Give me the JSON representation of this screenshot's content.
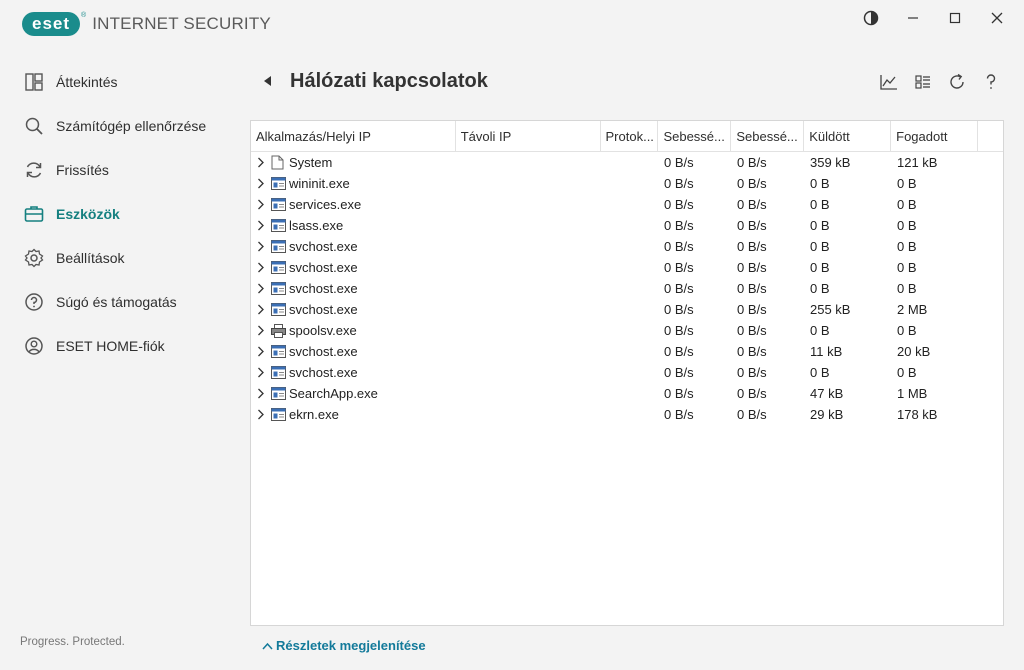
{
  "app": {
    "logo_text": "eset",
    "product_name": "INTERNET SECURITY"
  },
  "sidebar": {
    "items": [
      {
        "label": "Áttekintés",
        "icon": "overview-icon",
        "active": false
      },
      {
        "label": "Számítógép ellenőrzése",
        "icon": "scan-icon",
        "active": false
      },
      {
        "label": "Frissítés",
        "icon": "refresh-icon",
        "active": false
      },
      {
        "label": "Eszközök",
        "icon": "toolbox-icon",
        "active": true
      },
      {
        "label": "Beállítások",
        "icon": "gear-icon",
        "active": false
      },
      {
        "label": "Súgó és támogatás",
        "icon": "help-icon",
        "active": false
      },
      {
        "label": "ESET HOME-fiók",
        "icon": "account-icon",
        "active": false
      }
    ],
    "footer": "Progress. Protected."
  },
  "page": {
    "title": "Hálózati kapcsolatok",
    "details_link": "Részletek megjelenítése"
  },
  "table": {
    "columns": [
      "Alkalmazás/Helyi IP",
      "Távoli IP",
      "Protok...",
      "Sebessé...",
      "Sebessé...",
      "Küldött",
      "Fogadott",
      ""
    ],
    "rows": [
      {
        "app": "System",
        "remote": "",
        "proto": "",
        "speed_in": "0 B/s",
        "speed_out": "0 B/s",
        "sent": "359 kB",
        "received": "121 kB",
        "icon": "file"
      },
      {
        "app": "wininit.exe",
        "remote": "",
        "proto": "",
        "speed_in": "0 B/s",
        "speed_out": "0 B/s",
        "sent": "0 B",
        "received": "0 B",
        "icon": "window"
      },
      {
        "app": "services.exe",
        "remote": "",
        "proto": "",
        "speed_in": "0 B/s",
        "speed_out": "0 B/s",
        "sent": "0 B",
        "received": "0 B",
        "icon": "window"
      },
      {
        "app": "lsass.exe",
        "remote": "",
        "proto": "",
        "speed_in": "0 B/s",
        "speed_out": "0 B/s",
        "sent": "0 B",
        "received": "0 B",
        "icon": "window"
      },
      {
        "app": "svchost.exe",
        "remote": "",
        "proto": "",
        "speed_in": "0 B/s",
        "speed_out": "0 B/s",
        "sent": "0 B",
        "received": "0 B",
        "icon": "window"
      },
      {
        "app": "svchost.exe",
        "remote": "",
        "proto": "",
        "speed_in": "0 B/s",
        "speed_out": "0 B/s",
        "sent": "0 B",
        "received": "0 B",
        "icon": "window"
      },
      {
        "app": "svchost.exe",
        "remote": "",
        "proto": "",
        "speed_in": "0 B/s",
        "speed_out": "0 B/s",
        "sent": "0 B",
        "received": "0 B",
        "icon": "window"
      },
      {
        "app": "svchost.exe",
        "remote": "",
        "proto": "",
        "speed_in": "0 B/s",
        "speed_out": "0 B/s",
        "sent": "255 kB",
        "received": "2 MB",
        "icon": "window"
      },
      {
        "app": "spoolsv.exe",
        "remote": "",
        "proto": "",
        "speed_in": "0 B/s",
        "speed_out": "0 B/s",
        "sent": "0 B",
        "received": "0 B",
        "icon": "printer"
      },
      {
        "app": "svchost.exe",
        "remote": "",
        "proto": "",
        "speed_in": "0 B/s",
        "speed_out": "0 B/s",
        "sent": "11 kB",
        "received": "20 kB",
        "icon": "window"
      },
      {
        "app": "svchost.exe",
        "remote": "",
        "proto": "",
        "speed_in": "0 B/s",
        "speed_out": "0 B/s",
        "sent": "0 B",
        "received": "0 B",
        "icon": "window"
      },
      {
        "app": "SearchApp.exe",
        "remote": "",
        "proto": "",
        "speed_in": "0 B/s",
        "speed_out": "0 B/s",
        "sent": "47 kB",
        "received": "1 MB",
        "icon": "window"
      },
      {
        "app": "ekrn.exe",
        "remote": "",
        "proto": "",
        "speed_in": "0 B/s",
        "speed_out": "0 B/s",
        "sent": "29 kB",
        "received": "178 kB",
        "icon": "window"
      }
    ]
  },
  "colors": {
    "accent": "#158080",
    "link": "#137a9a"
  }
}
